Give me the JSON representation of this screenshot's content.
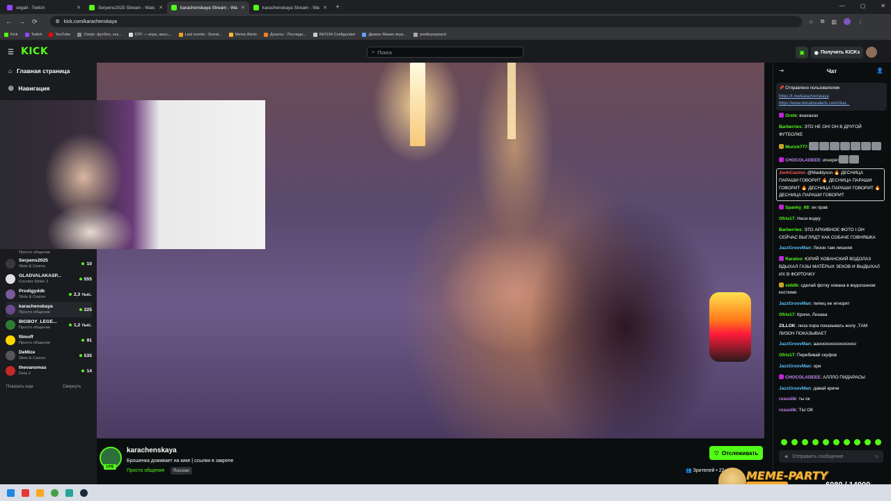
{
  "browser": {
    "tabs": [
      {
        "label": "segall - Twitch",
        "icon": "twitch",
        "active": false
      },
      {
        "label": "Serpens2025 Stream - Watch Li",
        "icon": "kick",
        "active": false
      },
      {
        "label": "karachenskaya Stream - Watch",
        "icon": "kick",
        "active": true
      },
      {
        "label": "karachenskaya Stream - Watch",
        "icon": "kick",
        "active": false
      }
    ],
    "new_tab": "+",
    "url": "kick.com/karachenskaya",
    "bookmarks": [
      "Kick",
      "Twitch",
      "YouTube",
      "Спорт: футбол, хок...",
      "DTF — игры, кино,...",
      "Last events - Donat...",
      "Meme Alerts",
      "Донаты - Последн...",
      "INO104 Configurator",
      "Дракон Манис игра...",
      "predloyseprach"
    ]
  },
  "header": {
    "logo": "KICK",
    "search_placeholder": "Поиск",
    "get_kicks_label": "Получить KICKs"
  },
  "sidebar": {
    "home": "Главная страница",
    "navigation": "Навигация",
    "top_channel_category": "Просто общение",
    "channels": [
      {
        "name": "Serpens2025",
        "category": "Slots & Casino",
        "viewers": "10",
        "color": "#3a3a3a"
      },
      {
        "name": "GLADVALAKASP...",
        "category": "Counter-Strike 2",
        "viewers": "555",
        "color": "#e0e0e0"
      },
      {
        "name": "Prodigyddk",
        "category": "Slots & Casino",
        "viewers": "2,3 тыс.",
        "color": "#7a5a9a"
      },
      {
        "name": "karachenskaya",
        "category": "Просто общение",
        "viewers": "225",
        "color": "#6a4a8a"
      },
      {
        "name": "BIGBOY_LEGE...",
        "category": "Просто общение",
        "viewers": "1,2 тыс.",
        "color": "#2e7d32"
      },
      {
        "name": "filmoff",
        "category": "Просто общение",
        "viewers": "91",
        "color": "#ffd600"
      },
      {
        "name": "DeMize",
        "category": "Slots & Casino",
        "viewers": "535",
        "color": "#555"
      },
      {
        "name": "thevanomas",
        "category": "Dota 2",
        "viewers": "14",
        "color": "#c62828"
      }
    ],
    "show_more": "Показать еще",
    "collapse": "Свернуть"
  },
  "stream": {
    "streamer": "karachenskaya",
    "title": "Брошенка доживает на кике | ссылки в закрепе",
    "category": "Просто общение",
    "language": "Russian",
    "live_badge": "LIVE",
    "follow_label": "Отслеживать",
    "viewers_label": "Зрителей • 22"
  },
  "chat": {
    "title": "Чат",
    "pinned_by": "Отправлено пользователем",
    "pinned_links": [
      "https://t.me/karachenskaya",
      "https://www.donationalerts.com/r/kar..."
    ],
    "messages": [
      {
        "user": "Grele",
        "text": ": вхахахах",
        "color": "#53fc18",
        "badge": "#c026d3"
      },
      {
        "user": "Barberries",
        "text": ": ЭТО НЕ ОН! ОН В ДРУГОЙ ФУТБОЛКЕ",
        "color": "#53fc18",
        "badge": ""
      },
      {
        "user": "Murick777",
        "text": ":",
        "color": "#53fc18",
        "badge": "#c9a227",
        "emotes": 7
      },
      {
        "user": "CHOCOLADEEE",
        "text": ": игнорят",
        "color": "#c58af9",
        "badge": "#c026d3",
        "emotes": 2
      },
      {
        "user": "JonhCasino",
        "text": ": @Maddyson 🔥 ДЕСНИЦА ПАРАШИ ГОВОРИТ 🔥 ДЕСНИЦА ПАРАШИ ГОВОРИТ 🔥 ДЕСНИЦА ПАРАШИ ГОВОРИТ 🔥 ДЕСНИЦА ПАРАШИ ГОВОРИТ",
        "color": "#ff5c5c",
        "badge": "",
        "highlight": true
      },
      {
        "user": "Spanky_68",
        "text": ": он прав",
        "color": "#53fc18",
        "badge": "#c026d3"
      },
      {
        "user": "Ofris17",
        "text": ": Неси водку",
        "color": "#53fc18",
        "badge": ""
      },
      {
        "user": "Barberries",
        "text": ": ЭТО АРХИВНОЕ ФОТО І ОН СЕЙЧАС ВЫГЛЯДТ КАК СОБАЧЕ ГОВНЯШКА",
        "color": "#53fc18",
        "badge": ""
      },
      {
        "user": "JazzGroovMan",
        "text": ": Лизон там лишняя",
        "color": "#5ec4ff",
        "badge": ""
      },
      {
        "user": "Raratoo",
        "text": ": ЮРИЙ ХОВАНСКИЙ ВОДОЛАЗ ВДЫХАЛ ГАЗЫ МАТЁРЫХ ЗЕКОВ И ВЫДЫХАЛ ИХ В ФОРТОЧКУ",
        "color": "#53fc18",
        "badge": "#c026d3"
      },
      {
        "user": "viddik",
        "text": ": сделай фотку хована в водолазном костюме",
        "color": "#53fc18",
        "badge": "#c9a227"
      },
      {
        "user": "JazzGroovMan",
        "text": ": пипец ее игнорят",
        "color": "#5ec4ff",
        "badge": ""
      },
      {
        "user": "Ofris17",
        "text": ": Кричи, Лизааа",
        "color": "#53fc18",
        "badge": ""
      },
      {
        "user": "ZILLOK",
        "text": ": лиза пора показывать жопу ,ТАМ ЛИЗОН ПОКАЗЫВАЕТ",
        "color": "#ffffff",
        "badge": ""
      },
      {
        "user": "JazzGroovMan",
        "text": ": ааооооооооооооооо",
        "color": "#5ec4ff",
        "badge": ""
      },
      {
        "user": "Ofris17",
        "text": ": Перебивай скуфов",
        "color": "#53fc18",
        "badge": ""
      },
      {
        "user": "JazzGroovMan",
        "text": ": ори",
        "color": "#5ec4ff",
        "badge": ""
      },
      {
        "user": "CHOCOLADEEE",
        "text": ": АЛЛЛО ПИДАРАСЫ",
        "color": "#c58af9",
        "badge": "#c026d3"
      },
      {
        "user": "JazzGroovMan",
        "text": ": давай кричи",
        "color": "#5ec4ff",
        "badge": ""
      },
      {
        "user": "rususlik",
        "text": ": ты ок",
        "color": "#c58af9",
        "badge": ""
      },
      {
        "user": "rususlik",
        "text": ": ТЫ ОК",
        "color": "#c58af9",
        "badge": ""
      }
    ],
    "input_placeholder": "Отправить сообщение"
  },
  "overlay": {
    "title": "MEME-PARTY",
    "count": "6080 / 14900"
  }
}
